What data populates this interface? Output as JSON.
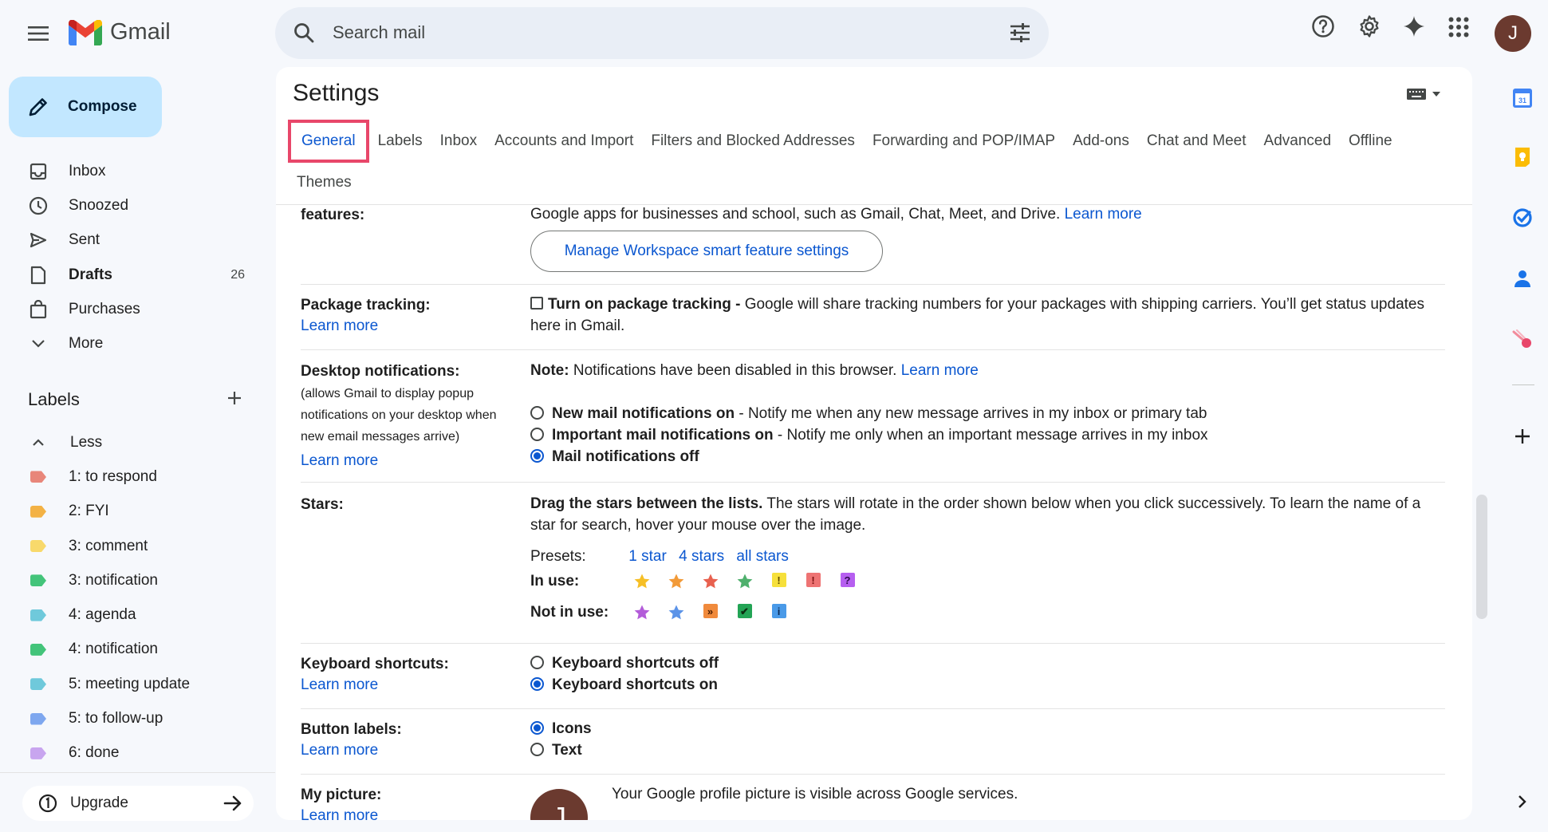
{
  "app": {
    "name": "Gmail"
  },
  "search": {
    "placeholder": "Search mail"
  },
  "avatar": {
    "initial": "J"
  },
  "compose": {
    "label": "Compose"
  },
  "nav": [
    {
      "label": "Inbox",
      "icon": "inbox-icon"
    },
    {
      "label": "Snoozed",
      "icon": "clock-icon"
    },
    {
      "label": "Sent",
      "icon": "send-icon"
    },
    {
      "label": "Drafts",
      "icon": "draft-icon",
      "count": "26",
      "bold": true
    },
    {
      "label": "Purchases",
      "icon": "shopping-bag-icon"
    },
    {
      "label": "More",
      "icon": "chevron-down-icon"
    }
  ],
  "labels": {
    "title": "Labels",
    "toggle": "Less",
    "items": [
      {
        "name": "1: to respond",
        "color": "#e8867a"
      },
      {
        "name": "2: FYI",
        "color": "#f3b245"
      },
      {
        "name": "3: comment",
        "color": "#f8d96b"
      },
      {
        "name": "3: notification",
        "color": "#43c47a"
      },
      {
        "name": "4: agenda",
        "color": "#6fc9db"
      },
      {
        "name": "4: notification",
        "color": "#43c47a"
      },
      {
        "name": "5: meeting update",
        "color": "#6fc9db"
      },
      {
        "name": "5: to follow-up",
        "color": "#7ea7ef"
      },
      {
        "name": "6: done",
        "color": "#c8a5ef"
      }
    ]
  },
  "upgrade": {
    "label": "Upgrade"
  },
  "settings": {
    "title": "Settings",
    "tabs": [
      "General",
      "Labels",
      "Inbox",
      "Accounts and Import",
      "Filters and Blocked Addresses",
      "Forwarding and POP/IMAP",
      "Add-ons",
      "Chat and Meet",
      "Advanced",
      "Offline",
      "Themes"
    ],
    "active_tab": "General",
    "smart": {
      "label_partial": "features:",
      "desc": "Google apps for businesses and school, such as Gmail, Chat, Meet, and Drive.",
      "learn_more": "Learn more",
      "button": "Manage Workspace smart feature settings"
    },
    "package": {
      "label": "Package tracking:",
      "learn_more": "Learn more",
      "option_bold": "Turn on package tracking -",
      "option_desc": " Google will share tracking numbers for your packages with shipping carriers. You’ll get status updates here in Gmail."
    },
    "desktop": {
      "label": "Desktop notifications:",
      "sub": "(allows Gmail to display popup notifications on your desktop when new email messages arrive)",
      "learn_more": "Learn more",
      "note_bold": "Note:",
      "note": " Notifications have been disabled in this browser.",
      "note_link": "Learn more",
      "options": [
        {
          "bold": "New mail notifications on",
          "desc": " - Notify me when any new message arrives in my inbox or primary tab",
          "checked": false
        },
        {
          "bold": "Important mail notifications on",
          "desc": " - Notify me only when an important message arrives in my inbox",
          "checked": false
        },
        {
          "bold": "Mail notifications off",
          "desc": "",
          "checked": true
        }
      ]
    },
    "stars": {
      "label": "Stars:",
      "intro_bold": "Drag the stars between the lists.",
      "intro": "  The stars will rotate in the order shown below when you click successively. To learn the name of a star for search, hover your mouse over the image.",
      "presets_label": "Presets:",
      "presets": [
        "1 star",
        "4 stars",
        "all stars"
      ],
      "in_use_label": "In use:",
      "not_in_use_label": "Not in use:",
      "in_use": [
        {
          "icon": "yellow-star-icon",
          "kind": "star",
          "color": "#f6bf26"
        },
        {
          "icon": "orange-star-icon",
          "kind": "star",
          "color": "#f29a38"
        },
        {
          "icon": "red-star-icon",
          "kind": "star",
          "color": "#e8614f"
        },
        {
          "icon": "green-star-icon",
          "kind": "star",
          "color": "#4fb06d"
        },
        {
          "icon": "yellow-bang-icon",
          "kind": "sq",
          "glyph": "!",
          "color": "#f6e03b",
          "fg": "#5f4b00"
        },
        {
          "icon": "red-bang-icon",
          "kind": "sq",
          "glyph": "!",
          "color": "#ee7373",
          "fg": "#7a1010"
        },
        {
          "icon": "purple-question-icon",
          "kind": "sq",
          "glyph": "?",
          "color": "#b65ff0",
          "fg": "#2e0a4d"
        }
      ],
      "not_in_use": [
        {
          "icon": "purple-star-icon",
          "kind": "star",
          "color": "#b35cd9"
        },
        {
          "icon": "blue-star-icon",
          "kind": "star",
          "color": "#5b93e8"
        },
        {
          "icon": "orange-guillemet-icon",
          "kind": "sq",
          "glyph": "»",
          "color": "#f08a3c",
          "fg": "#4a1c00"
        },
        {
          "icon": "green-check-icon",
          "kind": "sq",
          "glyph": "✔",
          "color": "#23a455",
          "fg": "#0b2e10"
        },
        {
          "icon": "blue-info-icon",
          "kind": "sq",
          "glyph": "i",
          "color": "#4a9ae8",
          "fg": "#0a2a55"
        }
      ]
    },
    "keyboard": {
      "label": "Keyboard shortcuts:",
      "learn_more": "Learn more",
      "options": [
        {
          "label": "Keyboard shortcuts off",
          "checked": false
        },
        {
          "label": "Keyboard shortcuts on",
          "checked": true
        }
      ]
    },
    "buttons": {
      "label": "Button labels:",
      "learn_more": "Learn more",
      "options": [
        {
          "label": "Icons",
          "checked": true
        },
        {
          "label": "Text",
          "checked": false
        }
      ]
    },
    "picture": {
      "label": "My picture:",
      "learn_more": "Learn more",
      "desc": "Your Google profile picture is visible across Google services.",
      "initial": "J"
    }
  },
  "colors": {
    "accent": "#0b57d0",
    "highlight": "#e8476a",
    "compose_bg": "#c2e7ff"
  }
}
